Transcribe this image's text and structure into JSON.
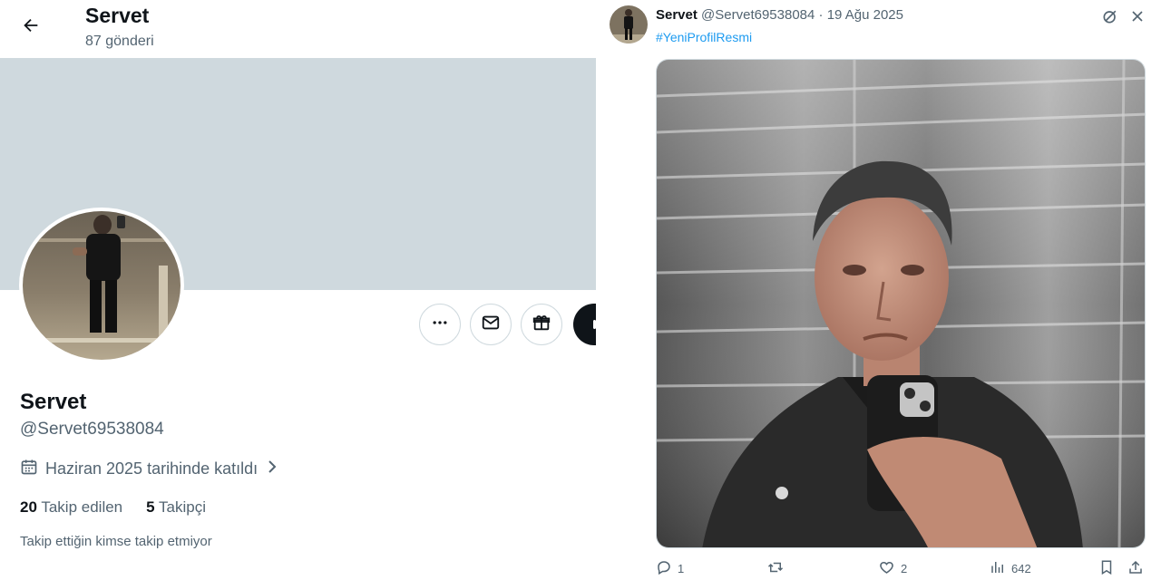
{
  "profile": {
    "header": {
      "name": "Servet",
      "post_count": "87 gönderi"
    },
    "name": "Servet",
    "handle": "@Servet69538084",
    "joined": "Haziran 2025 tarihinde katıldı",
    "stats": {
      "following_count": "20",
      "following_label": "Takip edilen",
      "followers_count": "5",
      "followers_label": "Takipçi"
    },
    "note": "Takip ettiğin kimse takip etmiyor"
  },
  "tweet": {
    "author_name": "Servet",
    "author_handle": "@Servet69538084",
    "separator": "·",
    "date": "19 Ağu 2025",
    "hashtag": "#YeniProfilResmi",
    "actions": {
      "replies": "1",
      "likes": "2",
      "views": "642"
    }
  },
  "icons": {
    "back": "arrow-left-icon",
    "more": "more-icon",
    "message": "envelope-icon",
    "gift": "gift-icon",
    "calendar": "calendar-icon",
    "grok": "grok-icon",
    "close": "close-icon",
    "reply": "reply-icon",
    "retweet": "retweet-icon",
    "like": "heart-icon",
    "views": "views-icon",
    "bookmark": "bookmark-icon",
    "share": "share-icon"
  },
  "colors": {
    "accent": "#1d9bf0",
    "banner": "#cfd9de",
    "text": "#0f1419",
    "muted": "#536471"
  }
}
